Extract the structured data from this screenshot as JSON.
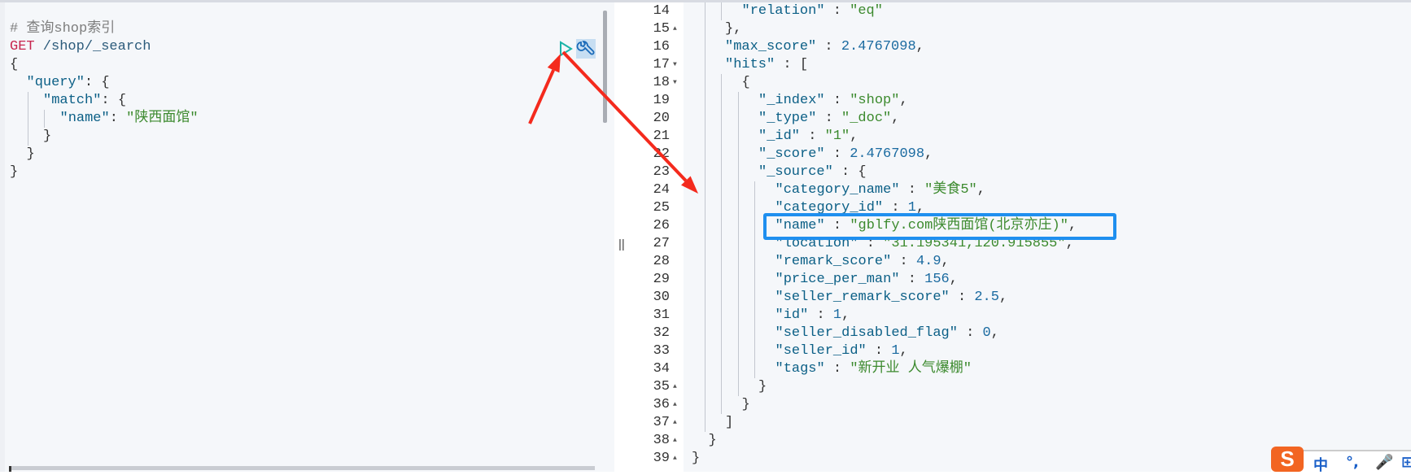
{
  "request_editor": {
    "lines": [
      {
        "level": 0,
        "tokens": [
          [
            "# 查询shop索引",
            "c"
          ]
        ]
      },
      {
        "level": 0,
        "tokens": [
          [
            "GET",
            "m"
          ],
          [
            " /shop/_search",
            "u"
          ]
        ]
      },
      {
        "level": 0,
        "tokens": [
          [
            "{",
            "p"
          ]
        ]
      },
      {
        "level": 1,
        "tokens": [
          [
            "\"query\"",
            "k"
          ],
          [
            ": {",
            "p"
          ]
        ]
      },
      {
        "level": 2,
        "tokens": [
          [
            "\"match\"",
            "k"
          ],
          [
            ": {",
            "p"
          ]
        ]
      },
      {
        "level": 3,
        "tokens": [
          [
            "\"name\"",
            "k"
          ],
          [
            ": ",
            "p"
          ],
          [
            "\"陕西面馆\"",
            "s"
          ]
        ]
      },
      {
        "level": 2,
        "tokens": [
          [
            "}",
            "p"
          ]
        ]
      },
      {
        "level": 1,
        "tokens": [
          [
            "}",
            "p"
          ]
        ]
      },
      {
        "level": 0,
        "tokens": [
          [
            "}",
            "p"
          ]
        ]
      }
    ],
    "run_icon": "play-icon",
    "settings_icon": "wrench-icon"
  },
  "divider_handle": "||",
  "response_viewer": {
    "lines": [
      {
        "num": "14",
        "fold": "",
        "level": 3,
        "tokens": [
          [
            "\"relation\"",
            "k"
          ],
          [
            " : ",
            "p"
          ],
          [
            "\"eq\"",
            "s"
          ]
        ]
      },
      {
        "num": "15",
        "fold": "▲",
        "level": 2,
        "tokens": [
          [
            "},",
            "p"
          ]
        ]
      },
      {
        "num": "16",
        "fold": "",
        "level": 2,
        "tokens": [
          [
            "\"max_score\"",
            "k"
          ],
          [
            " : ",
            "p"
          ],
          [
            "2.4767098",
            "n"
          ],
          [
            ",",
            "p"
          ]
        ]
      },
      {
        "num": "17",
        "fold": "▼",
        "level": 2,
        "tokens": [
          [
            "\"hits\"",
            "k"
          ],
          [
            " : [",
            "p"
          ]
        ]
      },
      {
        "num": "18",
        "fold": "▼",
        "level": 3,
        "tokens": [
          [
            "{",
            "p"
          ]
        ]
      },
      {
        "num": "19",
        "fold": "",
        "level": 4,
        "tokens": [
          [
            "\"_index\"",
            "k"
          ],
          [
            " : ",
            "p"
          ],
          [
            "\"shop\"",
            "s"
          ],
          [
            ",",
            "p"
          ]
        ]
      },
      {
        "num": "20",
        "fold": "",
        "level": 4,
        "tokens": [
          [
            "\"_type\"",
            "k"
          ],
          [
            " : ",
            "p"
          ],
          [
            "\"_doc\"",
            "s"
          ],
          [
            ",",
            "p"
          ]
        ]
      },
      {
        "num": "21",
        "fold": "",
        "level": 4,
        "tokens": [
          [
            "\"_id\"",
            "k"
          ],
          [
            " : ",
            "p"
          ],
          [
            "\"1\"",
            "s"
          ],
          [
            ",",
            "p"
          ]
        ]
      },
      {
        "num": "22",
        "fold": "",
        "level": 4,
        "tokens": [
          [
            "\"_score\"",
            "k"
          ],
          [
            " : ",
            "p"
          ],
          [
            "2.4767098",
            "n"
          ],
          [
            ",",
            "p"
          ]
        ]
      },
      {
        "num": "23",
        "fold": "",
        "level": 4,
        "tokens": [
          [
            "\"_source\"",
            "k"
          ],
          [
            " : {",
            "p"
          ]
        ]
      },
      {
        "num": "24",
        "fold": "",
        "level": 5,
        "tokens": [
          [
            "\"category_name\"",
            "k"
          ],
          [
            " : ",
            "p"
          ],
          [
            "\"美食5\"",
            "s"
          ],
          [
            ",",
            "p"
          ]
        ]
      },
      {
        "num": "25",
        "fold": "",
        "level": 5,
        "tokens": [
          [
            "\"category_id\"",
            "k"
          ],
          [
            " : ",
            "p"
          ],
          [
            "1",
            "n"
          ],
          [
            ",",
            "p"
          ]
        ]
      },
      {
        "num": "26",
        "fold": "",
        "level": 5,
        "tokens": [
          [
            "\"name\"",
            "k"
          ],
          [
            " : ",
            "p"
          ],
          [
            "\"gblfy.com陕西面馆(北京亦庄)\"",
            "s"
          ],
          [
            ",",
            "p"
          ]
        ]
      },
      {
        "num": "27",
        "fold": "",
        "level": 5,
        "tokens": [
          [
            "\"location\"",
            "k"
          ],
          [
            " : ",
            "p"
          ],
          [
            "\"31.195341,120.915855\"",
            "s"
          ],
          [
            ",",
            "p"
          ]
        ]
      },
      {
        "num": "28",
        "fold": "",
        "level": 5,
        "tokens": [
          [
            "\"remark_score\"",
            "k"
          ],
          [
            " : ",
            "p"
          ],
          [
            "4.9",
            "n"
          ],
          [
            ",",
            "p"
          ]
        ]
      },
      {
        "num": "29",
        "fold": "",
        "level": 5,
        "tokens": [
          [
            "\"price_per_man\"",
            "k"
          ],
          [
            " : ",
            "p"
          ],
          [
            "156",
            "n"
          ],
          [
            ",",
            "p"
          ]
        ]
      },
      {
        "num": "30",
        "fold": "",
        "level": 5,
        "tokens": [
          [
            "\"seller_remark_score\"",
            "k"
          ],
          [
            " : ",
            "p"
          ],
          [
            "2.5",
            "n"
          ],
          [
            ",",
            "p"
          ]
        ]
      },
      {
        "num": "31",
        "fold": "",
        "level": 5,
        "tokens": [
          [
            "\"id\"",
            "k"
          ],
          [
            " : ",
            "p"
          ],
          [
            "1",
            "n"
          ],
          [
            ",",
            "p"
          ]
        ]
      },
      {
        "num": "32",
        "fold": "",
        "level": 5,
        "tokens": [
          [
            "\"seller_disabled_flag\"",
            "k"
          ],
          [
            " : ",
            "p"
          ],
          [
            "0",
            "n"
          ],
          [
            ",",
            "p"
          ]
        ]
      },
      {
        "num": "33",
        "fold": "",
        "level": 5,
        "tokens": [
          [
            "\"seller_id\"",
            "k"
          ],
          [
            " : ",
            "p"
          ],
          [
            "1",
            "n"
          ],
          [
            ",",
            "p"
          ]
        ]
      },
      {
        "num": "34",
        "fold": "",
        "level": 5,
        "tokens": [
          [
            "\"tags\"",
            "k"
          ],
          [
            " : ",
            "p"
          ],
          [
            "\"新开业 人气爆棚\"",
            "s"
          ]
        ]
      },
      {
        "num": "35",
        "fold": "▲",
        "level": 4,
        "tokens": [
          [
            "}",
            "p"
          ]
        ]
      },
      {
        "num": "36",
        "fold": "▲",
        "level": 3,
        "tokens": [
          [
            "}",
            "p"
          ]
        ]
      },
      {
        "num": "37",
        "fold": "▲",
        "level": 2,
        "tokens": [
          [
            "]",
            "p"
          ]
        ]
      },
      {
        "num": "38",
        "fold": "▲",
        "level": 1,
        "tokens": [
          [
            "}",
            "p"
          ]
        ]
      },
      {
        "num": "39",
        "fold": "▲",
        "level": 0,
        "tokens": [
          [
            "}",
            "p"
          ]
        ]
      }
    ]
  },
  "annotations": {
    "arrow_color": "#f42a1d",
    "highlight_color": "#1f8fef"
  },
  "ime": {
    "logo": "S",
    "items": [
      "中",
      "°,",
      "🎤",
      "⊞"
    ]
  }
}
